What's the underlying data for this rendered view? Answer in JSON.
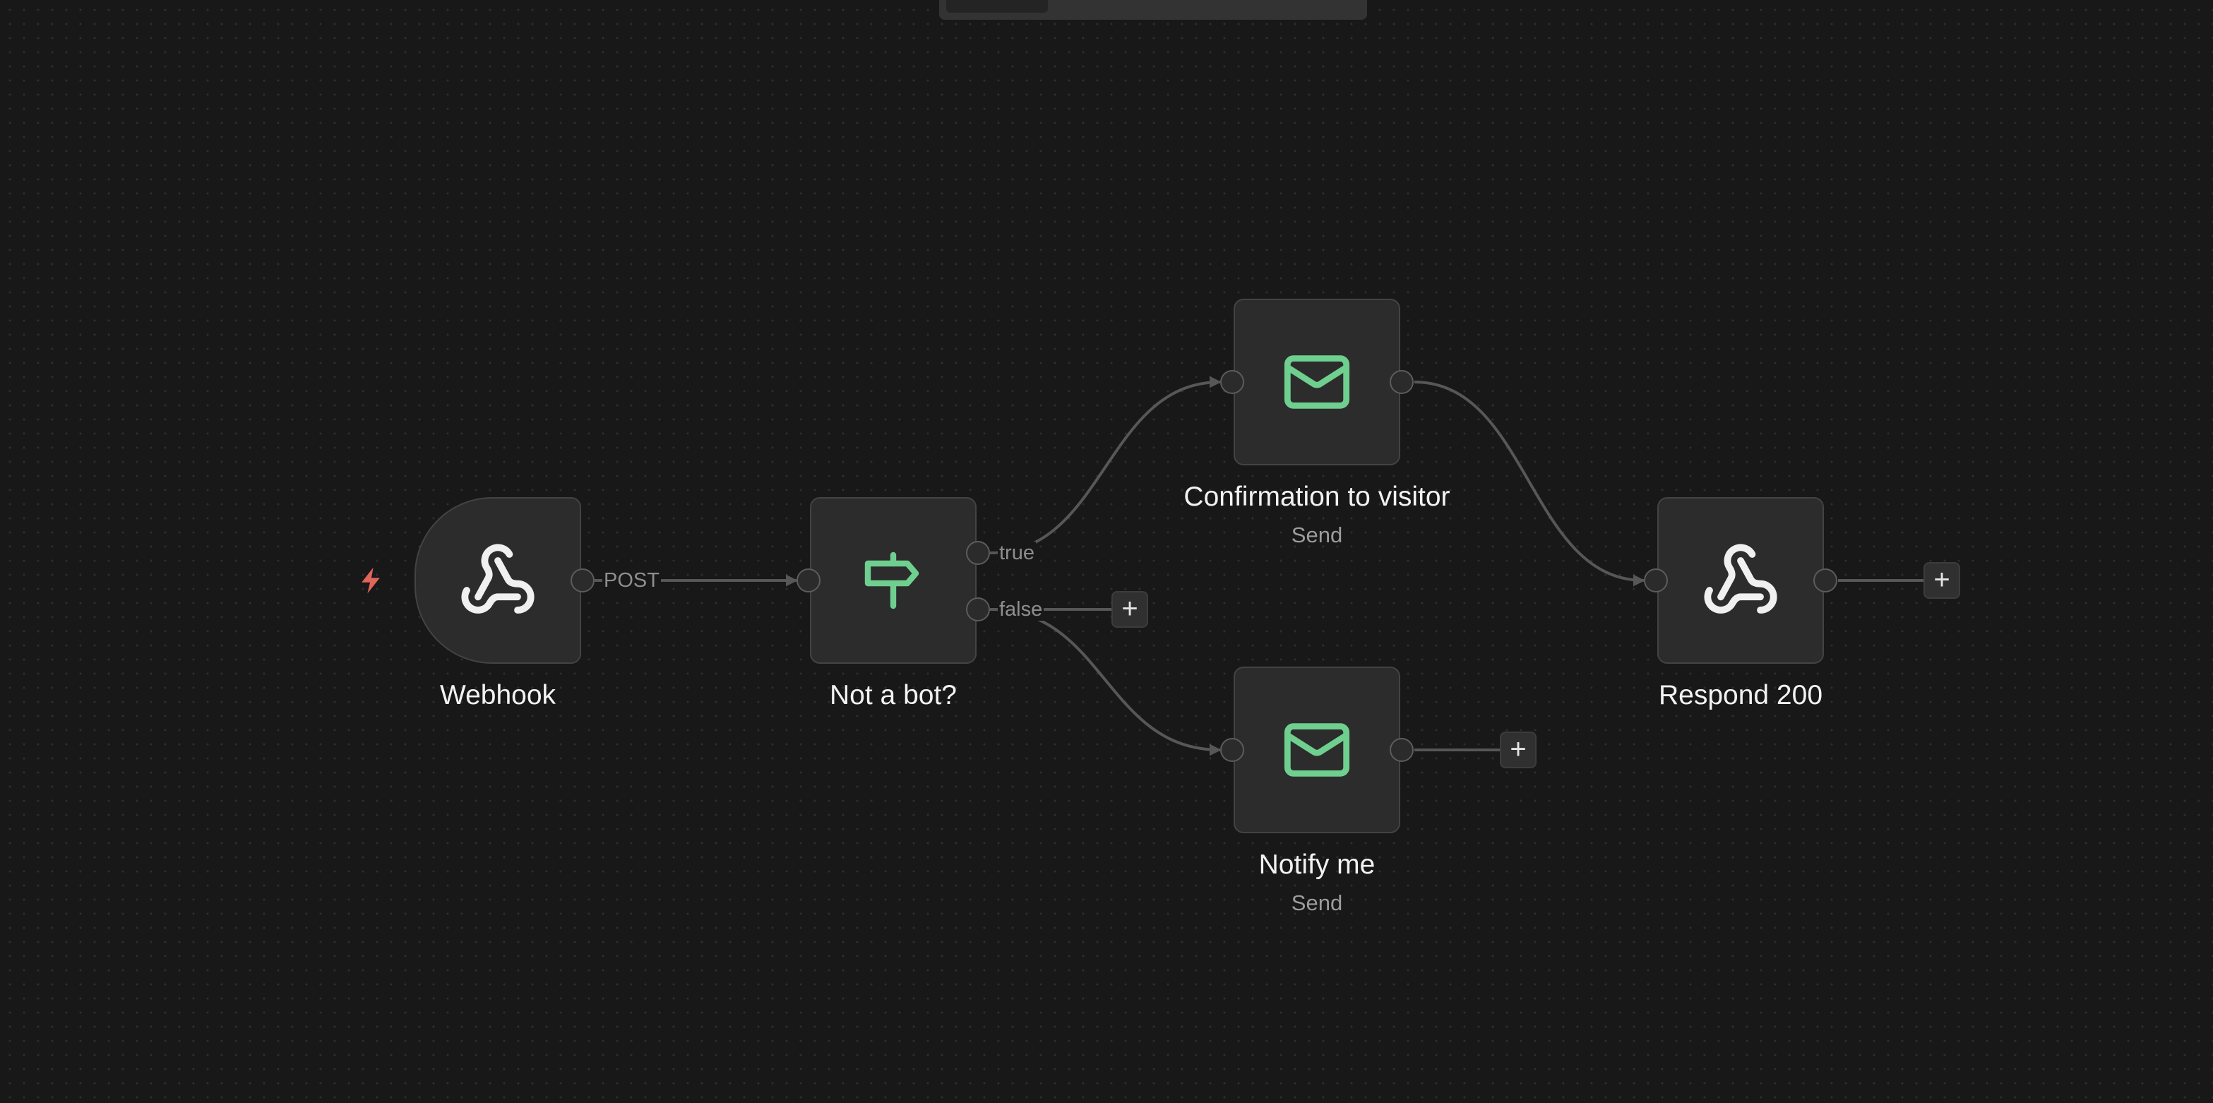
{
  "colors": {
    "canvas_bg": "#181818",
    "node_bg": "#2c2c2c",
    "node_border": "#434343",
    "accent_green": "#6fcf8f",
    "trigger_red": "#e0665a",
    "edge": "#575757"
  },
  "trigger_icon": "lightning-bolt-icon",
  "nodes": {
    "webhook": {
      "title": "Webhook",
      "icon": "webhook-icon"
    },
    "if": {
      "title": "Not a bot?",
      "icon": "signpost-icon"
    },
    "confirm": {
      "title": "Confirmation to visitor",
      "subtitle": "Send",
      "icon": "envelope-icon"
    },
    "notify": {
      "title": "Notify me",
      "subtitle": "Send",
      "icon": "envelope-icon"
    },
    "respond": {
      "title": "Respond 200",
      "icon": "webhook-icon"
    }
  },
  "edges": {
    "webhook_out_label": "POST",
    "if_true_label": "true",
    "if_false_label": "false"
  },
  "add_button_label": "+"
}
